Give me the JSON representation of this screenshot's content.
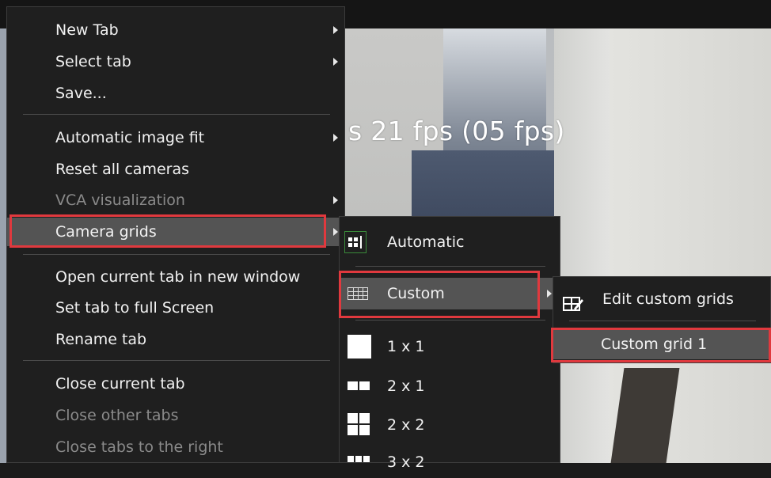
{
  "video": {
    "overlay_text": "s 21 fps (05 fps)"
  },
  "main_menu": {
    "items": [
      {
        "label": "New Tab",
        "has_submenu": true,
        "enabled": true
      },
      {
        "label": "Select tab",
        "has_submenu": true,
        "enabled": true
      },
      {
        "label": "Save...",
        "has_submenu": false,
        "enabled": true
      },
      {
        "label": "Automatic image fit",
        "has_submenu": true,
        "enabled": true
      },
      {
        "label": "Reset all cameras",
        "has_submenu": false,
        "enabled": true
      },
      {
        "label": "VCA visualization",
        "has_submenu": true,
        "enabled": false
      },
      {
        "label": "Camera grids",
        "has_submenu": true,
        "enabled": true,
        "highlighted": true
      },
      {
        "label": "Open current tab in new window",
        "has_submenu": false,
        "enabled": true
      },
      {
        "label": "Set tab to full Screen",
        "has_submenu": false,
        "enabled": true
      },
      {
        "label": "Rename tab",
        "has_submenu": false,
        "enabled": true
      },
      {
        "label": "Close current tab",
        "has_submenu": false,
        "enabled": true
      },
      {
        "label": "Close other tabs",
        "has_submenu": false,
        "enabled": false
      },
      {
        "label": "Close tabs to the right",
        "has_submenu": false,
        "enabled": false
      }
    ]
  },
  "camera_grids_menu": {
    "items": [
      {
        "label": "Automatic",
        "icon": "automatic-grid-icon"
      },
      {
        "label": "Custom",
        "icon": "custom-grid-icon",
        "has_submenu": true,
        "highlighted": true
      },
      {
        "label": "1 x 1",
        "icon": "grid-1x1-icon"
      },
      {
        "label": "2 x 1",
        "icon": "grid-2x1-icon"
      },
      {
        "label": "2 x 2",
        "icon": "grid-2x2-icon"
      },
      {
        "label": "3 x 2",
        "icon": "grid-3x2-icon"
      }
    ]
  },
  "custom_menu": {
    "items": [
      {
        "label": "Edit custom grids",
        "icon": "edit-grid-icon"
      },
      {
        "label": "Custom grid 1",
        "highlighted": true
      }
    ]
  },
  "colors": {
    "menu_bg": "#1f1f1f",
    "highlight_bg": "#545454",
    "annotation_red": "#e0393e",
    "disabled_text": "#8a8a8a"
  }
}
